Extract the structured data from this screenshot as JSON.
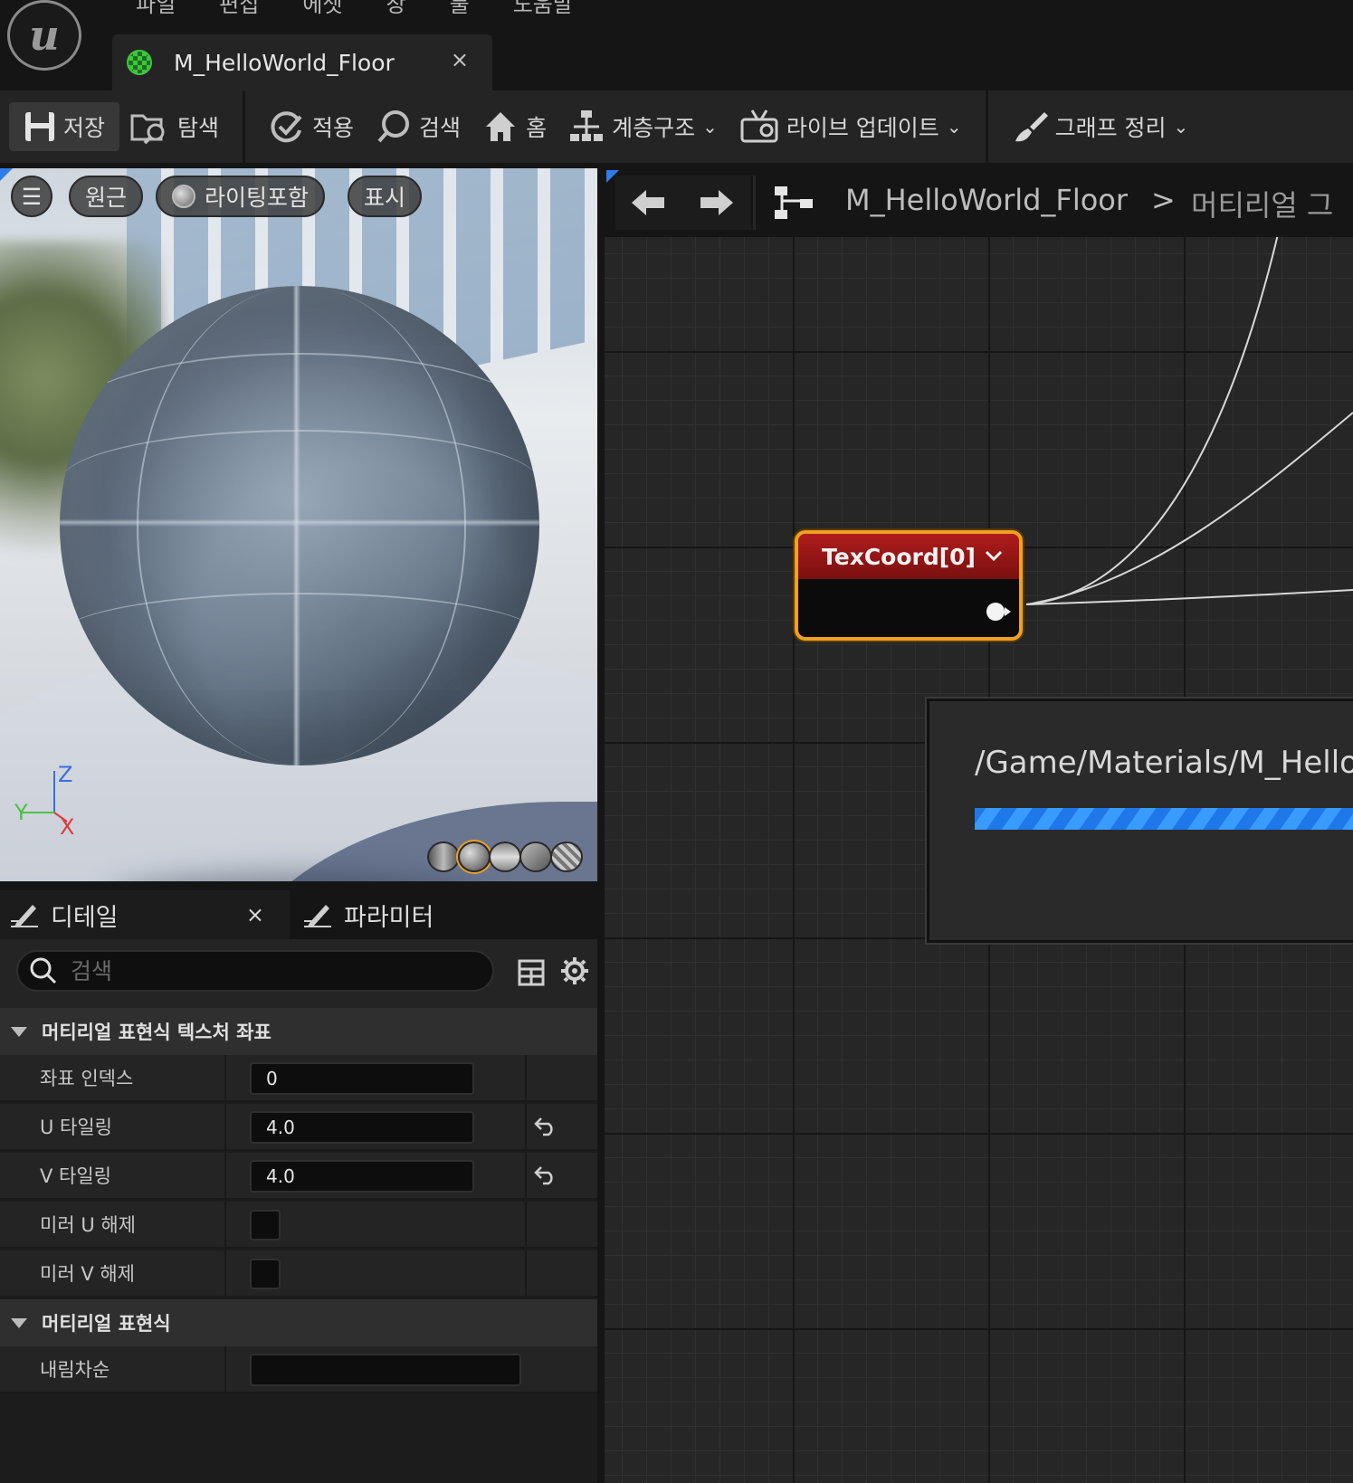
{
  "menu": [
    "파일",
    "편집",
    "에셋",
    "창",
    "툴",
    "도움말"
  ],
  "document_tab": {
    "title": "M_HelloWorld_Floor",
    "close": "×"
  },
  "toolbar": {
    "save": "저장",
    "browse": "탐색",
    "apply": "적용",
    "search": "검색",
    "home": "홈",
    "hierarchy": "계층구조",
    "live_update": "라이브 업데이트",
    "clean_graph": "그래프 정리"
  },
  "viewport": {
    "menu_glyph": "☰",
    "perspective": "원근",
    "lit": "라이팅포함",
    "show": "표시",
    "axis": {
      "z": "Z",
      "y": "Y",
      "x": "X"
    }
  },
  "details": {
    "tab_details": "디테일",
    "tab_close": "×",
    "tab_params": "파라미터",
    "search_placeholder": "검색",
    "categories": {
      "texcoord": "머티리얼 표현식 텍스처 좌표",
      "expression": "머티리얼 표현식"
    },
    "props": {
      "coord_index": {
        "label": "좌표 인덱스",
        "value": "0"
      },
      "u_tiling": {
        "label": "U 타일링",
        "value": "4.0"
      },
      "v_tiling": {
        "label": "V 타일링",
        "value": "4.0"
      },
      "unmirror_u": {
        "label": "미러 U 해제",
        "checked": false
      },
      "unmirror_v": {
        "label": "미러 V 해제",
        "checked": false
      },
      "desc": {
        "label": "내림차순",
        "value": ""
      }
    }
  },
  "graph": {
    "breadcrumb_asset": "M_HelloWorld_Floor",
    "breadcrumb_sep": ">",
    "breadcrumb_graph": "머티리얼 그",
    "node_title": "TexCoord[0]",
    "compile_path": "/Game/Materials/M_Hello"
  },
  "colors": {
    "node_border": "#f0a024",
    "node_header": "#b01c1c",
    "progress": "#1e78e8"
  }
}
